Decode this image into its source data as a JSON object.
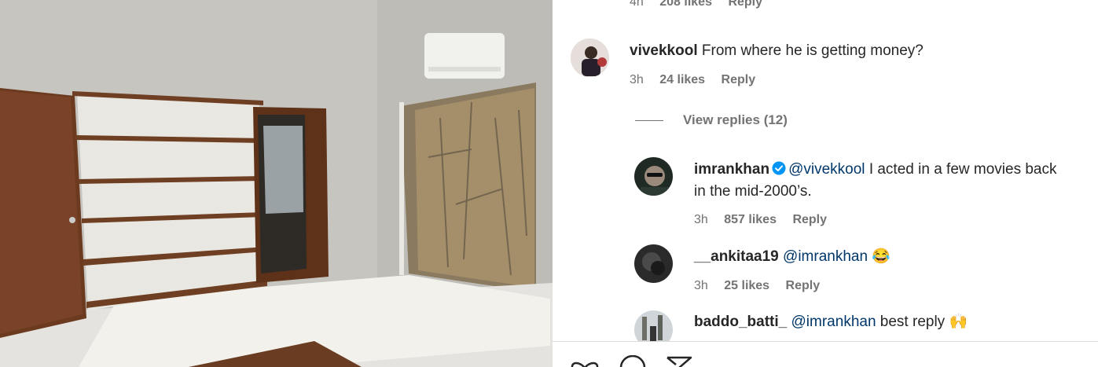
{
  "top_partial": {
    "time": "4h",
    "likes": "208 likes",
    "reply": "Reply"
  },
  "comments": [
    {
      "username": "vivekkool",
      "text": "From where he is getting money?",
      "time": "3h",
      "likes": "24 likes",
      "reply": "Reply"
    }
  ],
  "view_replies": "View replies (12)",
  "replies": [
    {
      "username": "imrankhan",
      "verified": true,
      "mention": "@vivekkool",
      "text_line1": "I acted in a few movies back",
      "text_line2": "in the mid-2000’s.",
      "time": "3h",
      "likes": "857 likes",
      "reply": "Reply"
    },
    {
      "username": "__ankitaa19",
      "mention": "@imrankhan",
      "emoji": "😂",
      "time": "3h",
      "likes": "25 likes",
      "reply": "Reply"
    },
    {
      "username": "baddo_batti_",
      "mention": "@imrankhan",
      "text": "best reply",
      "emoji": "🙌"
    }
  ],
  "actions": [
    "heart-icon",
    "comment-icon",
    "share-icon"
  ],
  "colors": {
    "mention": "#00376b",
    "verified": "#0095f6",
    "meta": "#737373"
  }
}
